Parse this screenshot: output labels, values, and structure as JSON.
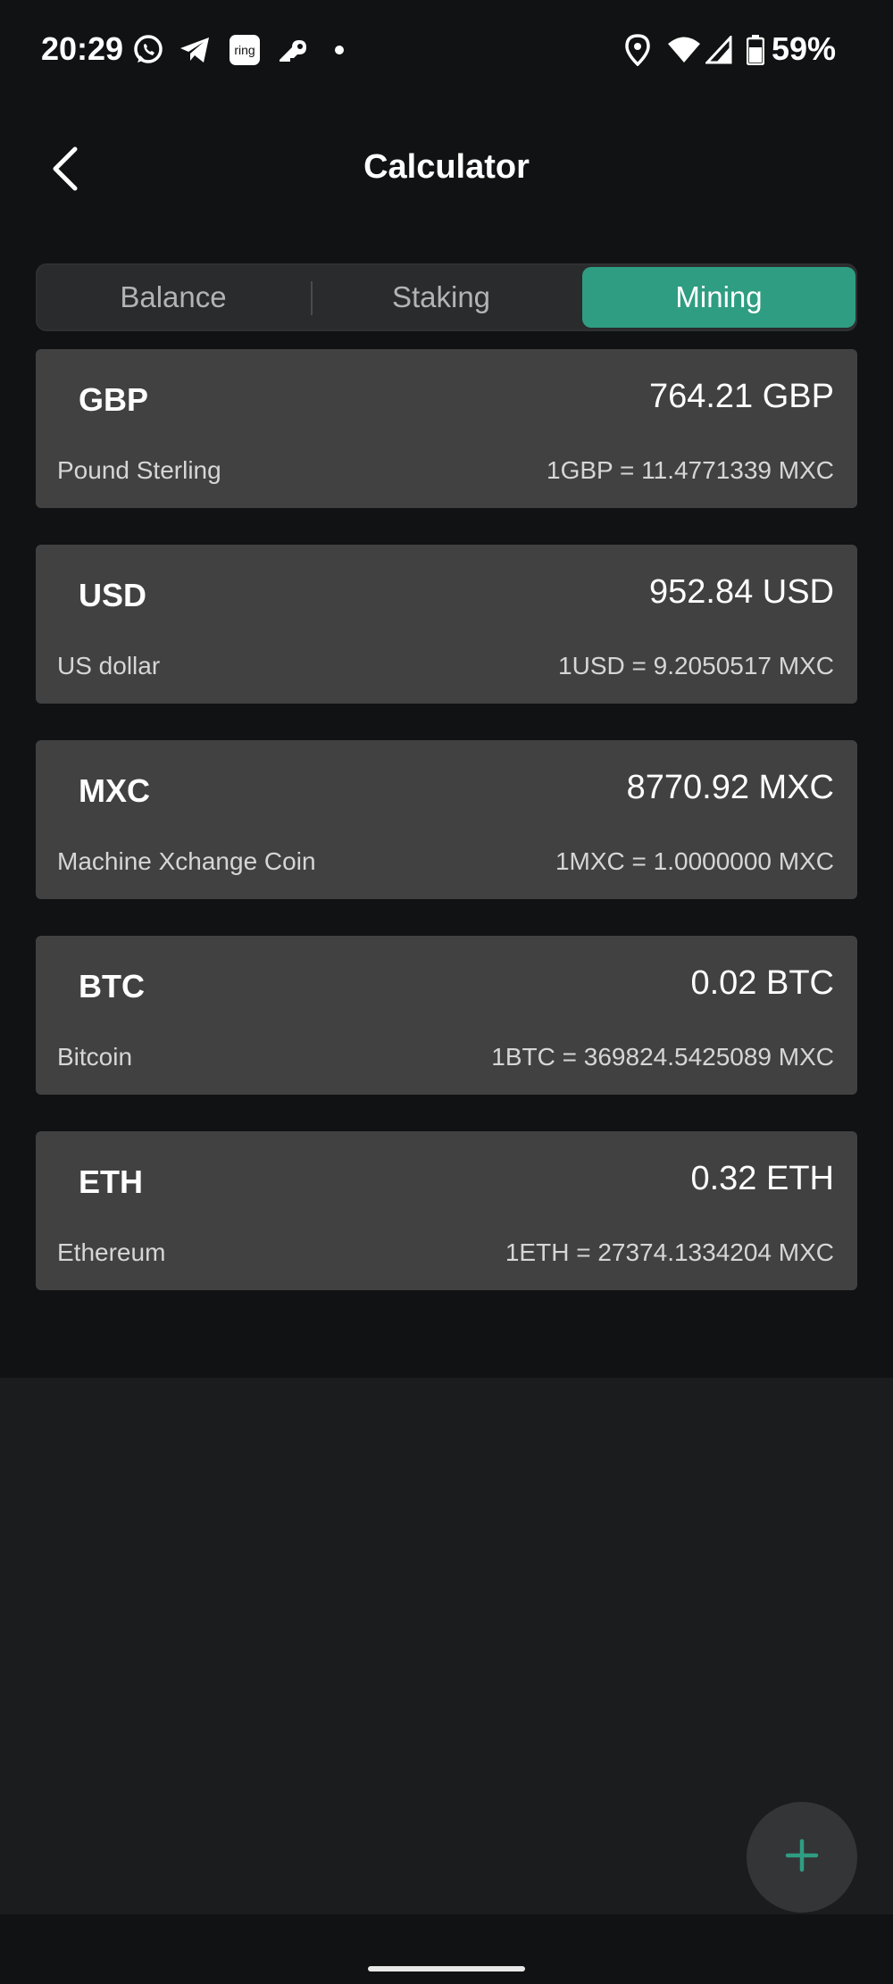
{
  "status_bar": {
    "time": "20:29",
    "left_icons": [
      "whatsapp-icon",
      "telegram-icon",
      "ring-icon",
      "key-icon",
      "dot-icon"
    ],
    "ring_label": "ring",
    "right_icons": [
      "location-icon",
      "wifi-icon",
      "cell-signal-icon",
      "battery-icon"
    ],
    "battery_percent": "59%"
  },
  "header": {
    "title": "Calculator",
    "back_icon": "chevron-left-icon"
  },
  "tabs": [
    {
      "label": "Balance",
      "active": false
    },
    {
      "label": "Staking",
      "active": false
    },
    {
      "label": "Mining",
      "active": true
    }
  ],
  "currencies": [
    {
      "code": "GBP",
      "amount": "764.21 GBP",
      "name": "Pound Sterling",
      "rate": "1GBP = 11.4771339 MXC"
    },
    {
      "code": "USD",
      "amount": "952.84 USD",
      "name": "US dollar",
      "rate": "1USD = 9.2050517 MXC"
    },
    {
      "code": "MXC",
      "amount": "8770.92 MXC",
      "name": "Machine Xchange Coin",
      "rate": "1MXC = 1.0000000 MXC"
    },
    {
      "code": "BTC",
      "amount": "0.02 BTC",
      "name": "Bitcoin",
      "rate": "1BTC = 369824.5425089 MXC"
    },
    {
      "code": "ETH",
      "amount": "0.32 ETH",
      "name": "Ethereum",
      "rate": "1ETH = 27374.1334204 MXC"
    }
  ],
  "fab": {
    "icon": "plus-icon"
  },
  "colors": {
    "accent": "#2f9d82",
    "background": "#111213",
    "card": "#414142"
  }
}
